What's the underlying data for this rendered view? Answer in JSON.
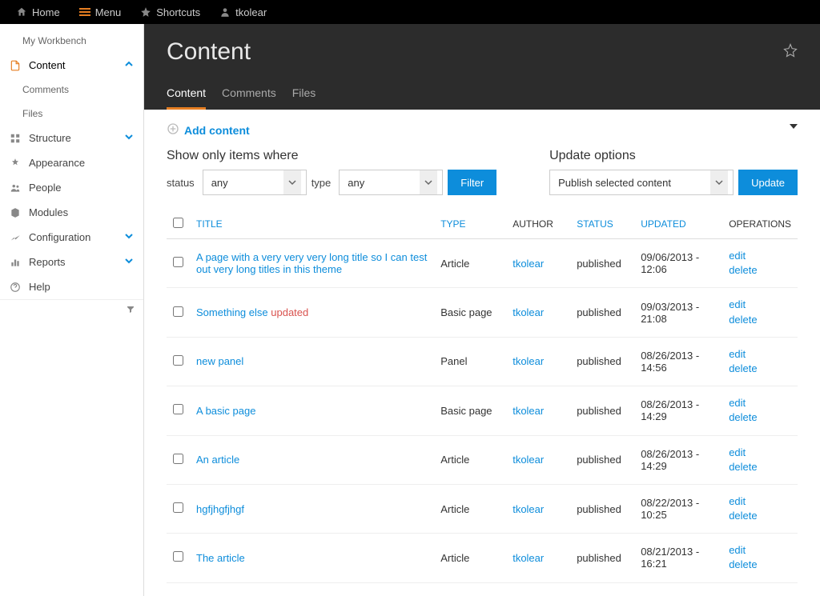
{
  "toolbar": {
    "home": "Home",
    "menu": "Menu",
    "shortcuts": "Shortcuts",
    "user": "tkolear"
  },
  "sidebar": {
    "items": [
      {
        "label": "My Workbench",
        "icon": "",
        "sub": true
      },
      {
        "label": "Content",
        "icon": "file",
        "active": true,
        "expandable": true,
        "open": true
      },
      {
        "label": "Comments",
        "icon": "",
        "sub": true
      },
      {
        "label": "Files",
        "icon": "",
        "sub": true
      },
      {
        "label": "Structure",
        "icon": "structure",
        "expandable": true
      },
      {
        "label": "Appearance",
        "icon": "appearance"
      },
      {
        "label": "People",
        "icon": "people"
      },
      {
        "label": "Modules",
        "icon": "modules"
      },
      {
        "label": "Configuration",
        "icon": "config",
        "expandable": true
      },
      {
        "label": "Reports",
        "icon": "reports",
        "expandable": true
      },
      {
        "label": "Help",
        "icon": "help"
      }
    ]
  },
  "header": {
    "title": "Content",
    "tabs": [
      {
        "label": "Content",
        "active": true
      },
      {
        "label": "Comments"
      },
      {
        "label": "Files"
      }
    ]
  },
  "actions": {
    "add_content": "Add content"
  },
  "filters": {
    "show_label": "Show only items where",
    "status_label": "status",
    "status_value": "any",
    "type_label": "type",
    "type_value": "any",
    "filter_btn": "Filter",
    "update_label": "Update options",
    "update_value": "Publish selected content",
    "update_btn": "Update"
  },
  "table": {
    "columns": {
      "title": "TITLE",
      "type": "TYPE",
      "author": "AUTHOR",
      "status": "STATUS",
      "updated": "UPDATED",
      "operations": "OPERATIONS"
    },
    "ops": {
      "edit": "edit",
      "delete": "delete"
    },
    "rows": [
      {
        "title": "A page with a very very very long title so I can test out very long titles in this theme",
        "badge": "",
        "type": "Article",
        "author": "tkolear",
        "status": "published",
        "updated": "09/06/2013 - 12:06"
      },
      {
        "title": "Something else",
        "badge": "updated",
        "type": "Basic page",
        "author": "tkolear",
        "status": "published",
        "updated": "09/03/2013 - 21:08"
      },
      {
        "title": "new panel",
        "badge": "",
        "type": "Panel",
        "author": "tkolear",
        "status": "published",
        "updated": "08/26/2013 - 14:56"
      },
      {
        "title": "A basic page",
        "badge": "",
        "type": "Basic page",
        "author": "tkolear",
        "status": "published",
        "updated": "08/26/2013 - 14:29"
      },
      {
        "title": "An article",
        "badge": "",
        "type": "Article",
        "author": "tkolear",
        "status": "published",
        "updated": "08/26/2013 - 14:29"
      },
      {
        "title": "hgfjhgfjhgf",
        "badge": "",
        "type": "Article",
        "author": "tkolear",
        "status": "published",
        "updated": "08/22/2013 - 10:25"
      },
      {
        "title": "The article",
        "badge": "",
        "type": "Article",
        "author": "tkolear",
        "status": "published",
        "updated": "08/21/2013 - 16:21"
      }
    ]
  }
}
